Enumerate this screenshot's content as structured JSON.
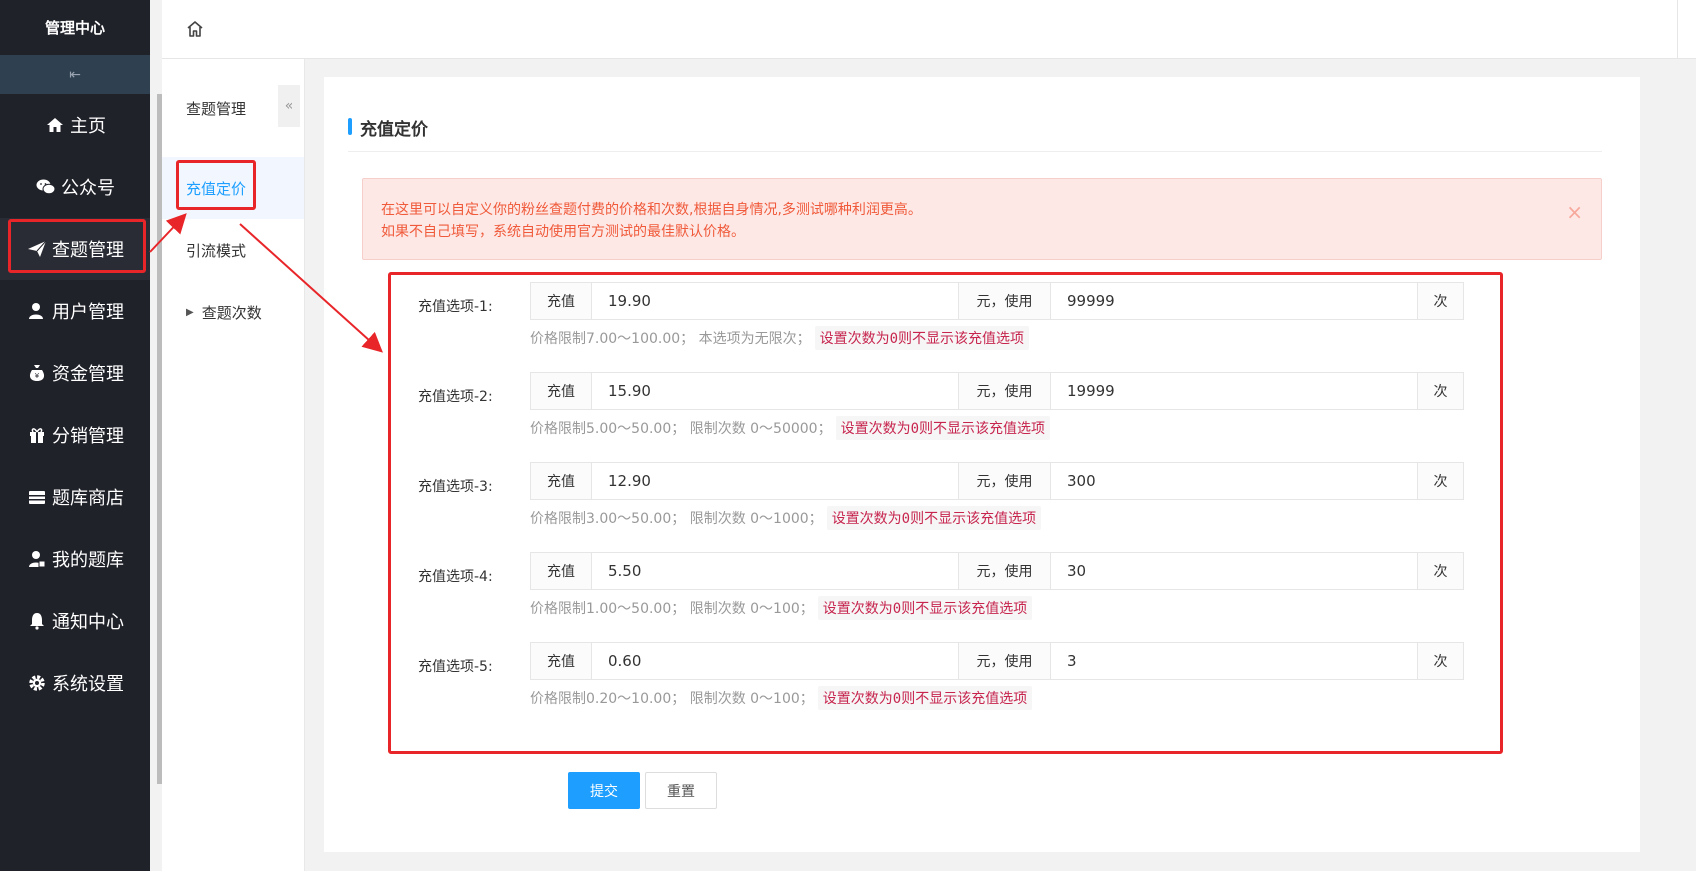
{
  "app": {
    "brand": "管理中心"
  },
  "sidebar": {
    "collapse_glyph": "⇤",
    "items": [
      {
        "label": "主页",
        "icon": "home-icon"
      },
      {
        "label": "公众号",
        "icon": "wechat-icon"
      },
      {
        "label": "查题管理",
        "icon": "paper-plane-icon",
        "active": true
      },
      {
        "label": "用户管理",
        "icon": "user-icon"
      },
      {
        "label": "资金管理",
        "icon": "money-bag-icon"
      },
      {
        "label": "分销管理",
        "icon": "gift-icon"
      },
      {
        "label": "题库商店",
        "icon": "store-icon"
      },
      {
        "label": "我的题库",
        "icon": "user-book-icon"
      },
      {
        "label": "通知中心",
        "icon": "bell-icon"
      },
      {
        "label": "系统设置",
        "icon": "gear-icon"
      }
    ]
  },
  "subnav": {
    "title": "查题管理",
    "fold_glyph": "«",
    "items": [
      {
        "label": "充值定价",
        "active": true
      },
      {
        "label": "引流模式"
      },
      {
        "label": "查题次数",
        "expandable": true
      }
    ]
  },
  "main": {
    "section_title": "充值定价",
    "alert": {
      "line1": "在这里可以自定义你的粉丝查题付费的价格和次数,根据自身情况,多测试哪种利润更高。",
      "line2": "如果不自己填写，系统自动使用官方测试的最佳默认价格。",
      "close": "×"
    },
    "options": [
      {
        "label": "充值选项-1:",
        "prefix": "充值",
        "price": "19.90",
        "middle": "元，使用",
        "count": "99999",
        "suffix": "次",
        "hint": "价格限制7.00～100.00；  本选项为无限次；",
        "note": "设置次数为0则不显示该充值选项"
      },
      {
        "label": "充值选项-2:",
        "prefix": "充值",
        "price": "15.90",
        "middle": "元，使用",
        "count": "19999",
        "suffix": "次",
        "hint": "价格限制5.00～50.00；  限制次数 0～50000；",
        "note": "设置次数为0则不显示该充值选项"
      },
      {
        "label": "充值选项-3:",
        "prefix": "充值",
        "price": "12.90",
        "middle": "元，使用",
        "count": "300",
        "suffix": "次",
        "hint": "价格限制3.00～50.00；  限制次数 0～1000；",
        "note": "设置次数为0则不显示该充值选项"
      },
      {
        "label": "充值选项-4:",
        "prefix": "充值",
        "price": "5.50",
        "middle": "元，使用",
        "count": "30",
        "suffix": "次",
        "hint": "价格限制1.00～50.00；  限制次数 0～100；",
        "note": "设置次数为0则不显示该充值选项"
      },
      {
        "label": "充值选项-5:",
        "prefix": "充值",
        "price": "0.60",
        "middle": "元，使用",
        "count": "3",
        "suffix": "次",
        "hint": "价格限制0.20～10.00；  限制次数 0～100；",
        "note": "设置次数为0则不显示该充值选项"
      }
    ],
    "submit_label": "提交",
    "reset_label": "重置"
  },
  "colors": {
    "accent": "#1e9fff",
    "sidebar_bg": "#20222a",
    "highlight": "#e8262a",
    "alert_text": "#f05a3a",
    "code_text": "#c7254e"
  }
}
